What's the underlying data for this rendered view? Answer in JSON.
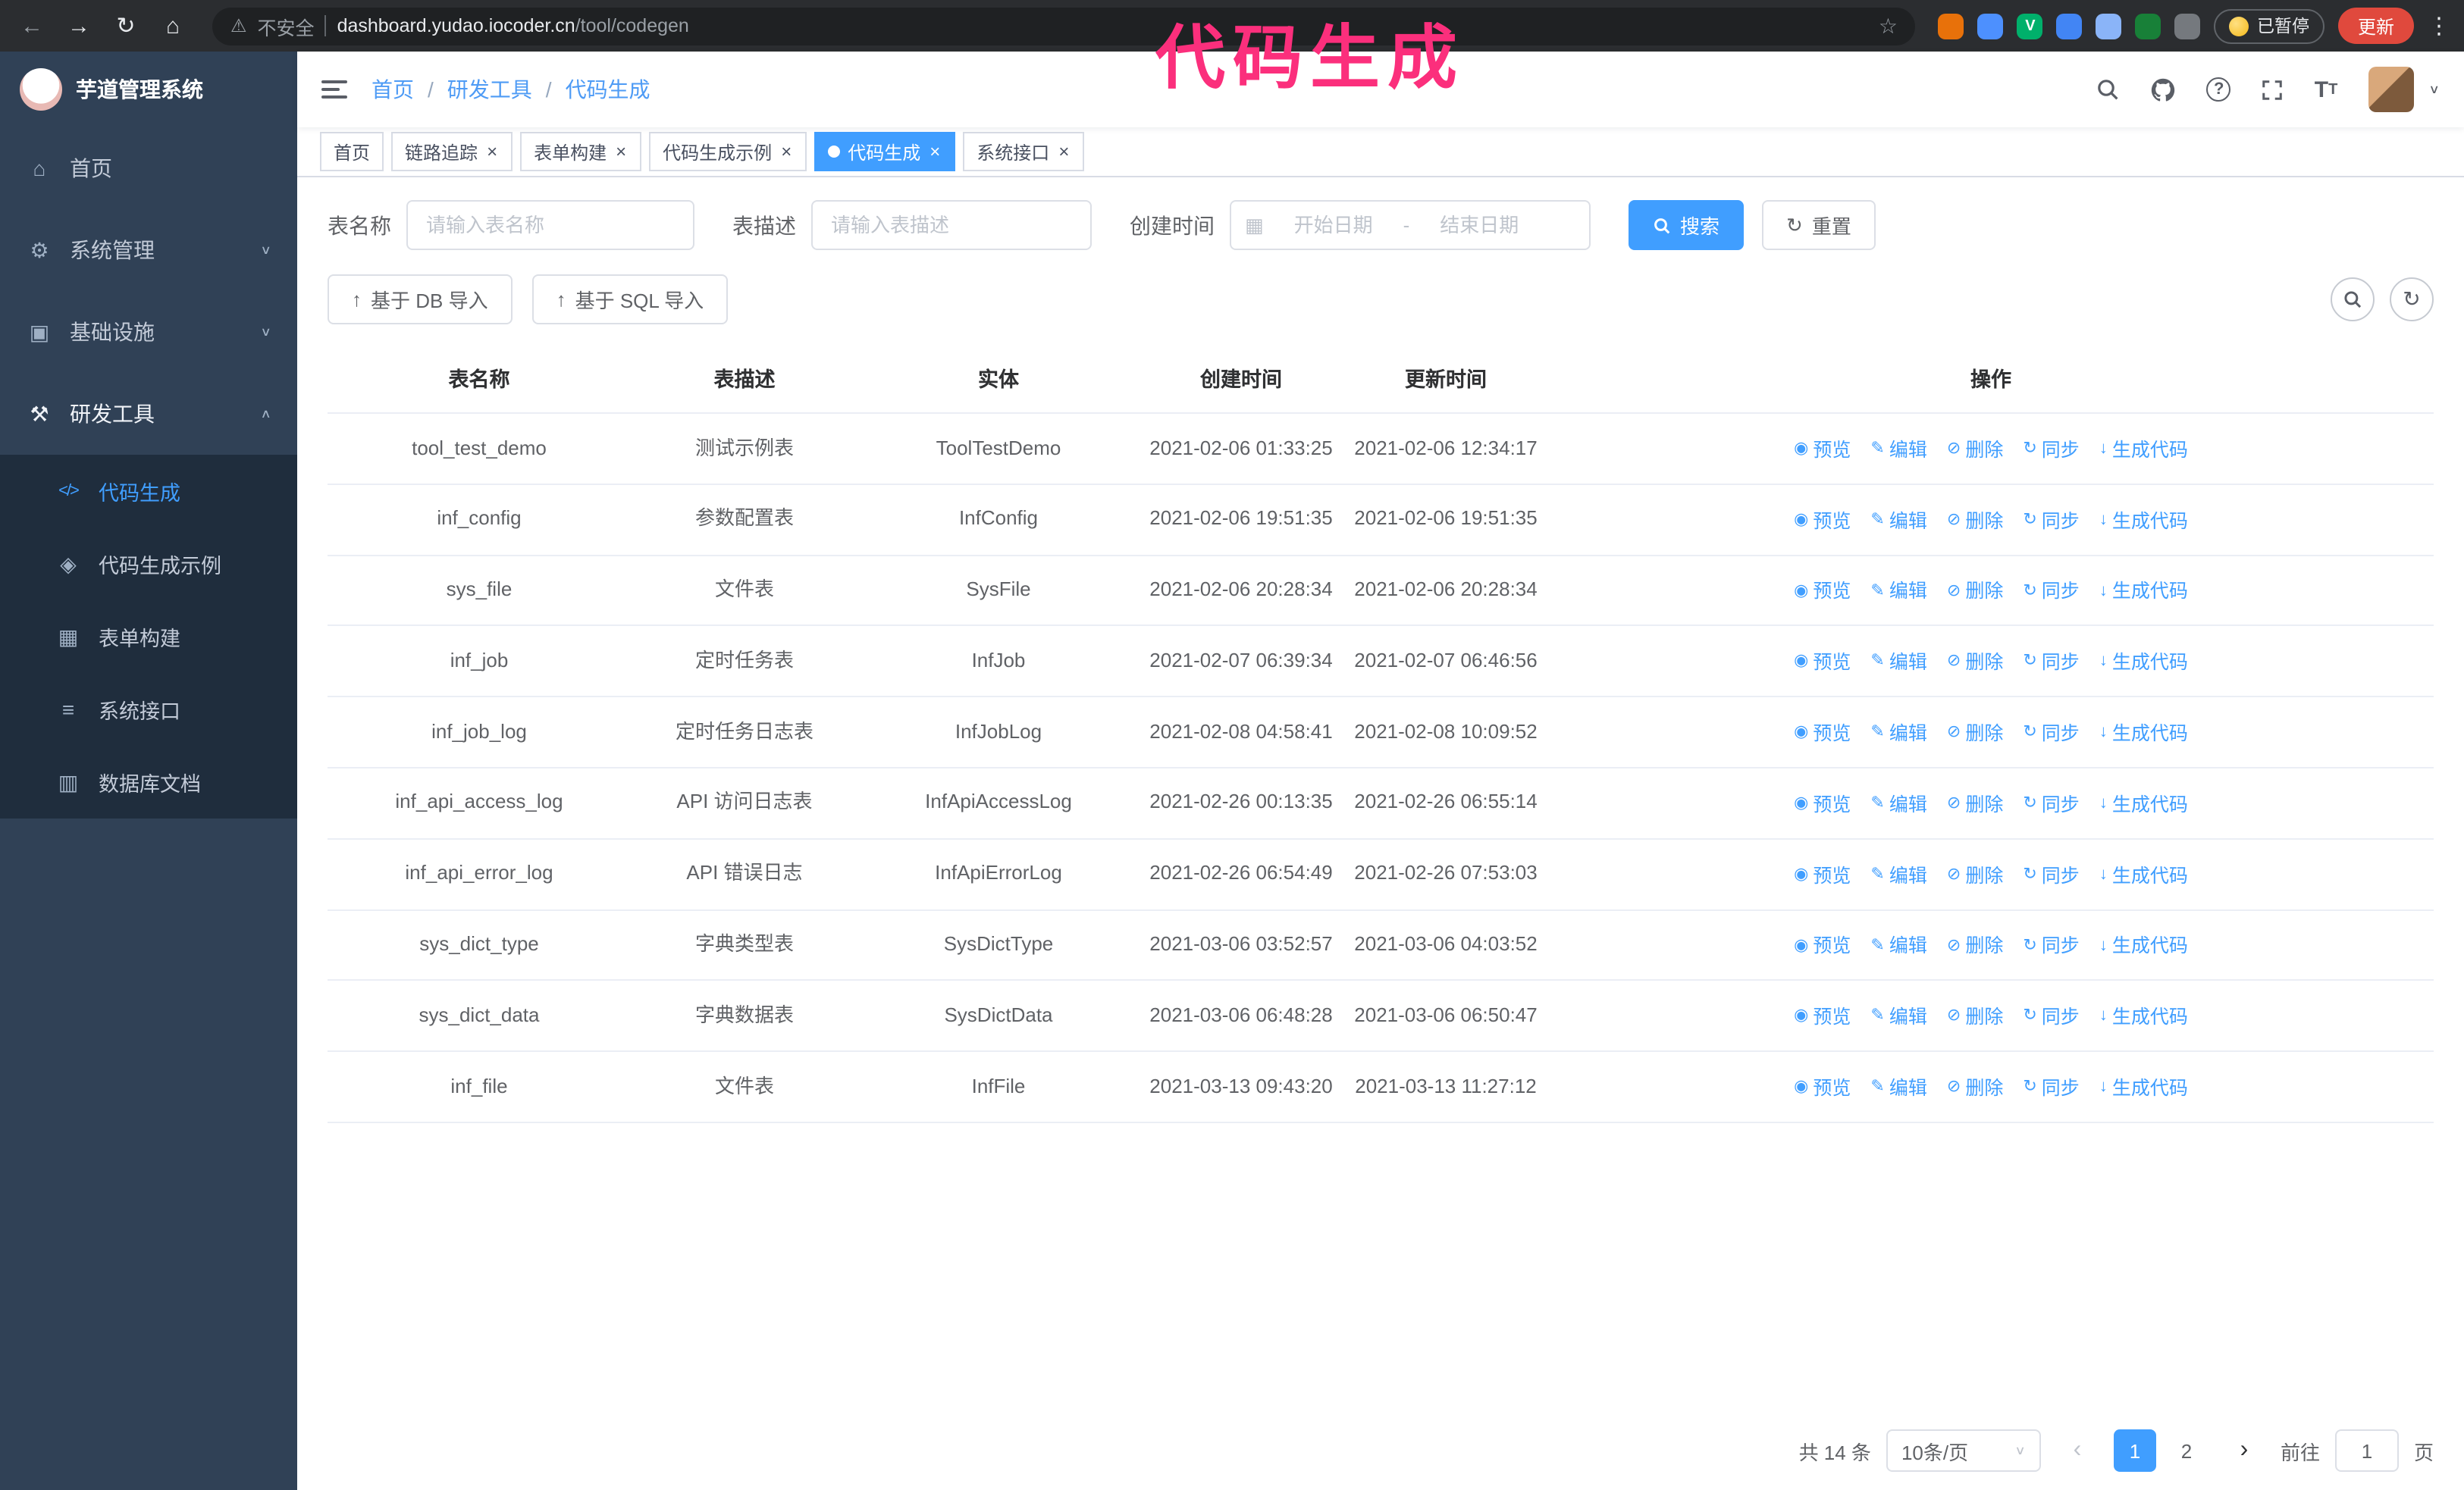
{
  "colors": {
    "primary": "#409eff",
    "sidebar_bg": "#304156",
    "submenu_bg": "#1f2d3d",
    "annotation_pink": "#fb2f7c",
    "update_red": "#e0493d",
    "browser_bar": "#2b2d30"
  },
  "annotation": "代码生成",
  "browser": {
    "warning": "不安全",
    "url_host": "dashboard.yudao.iocoder.cn",
    "url_path": "/tool/codegen",
    "paused_badge": "已暂停",
    "update_button": "更新",
    "extensions": [
      {
        "name": "extension-orange-icon",
        "bg": "#e8710a",
        "glyph": ""
      },
      {
        "name": "extension-blue-drop-icon",
        "bg": "#4d90fe",
        "glyph": ""
      },
      {
        "name": "extension-green-v-icon",
        "bg": "#00b06b",
        "glyph": "V"
      },
      {
        "name": "extension-people-icon",
        "bg": "#4285f4",
        "glyph": ""
      },
      {
        "name": "extension-translate-icon",
        "bg": "#8ab4f8",
        "glyph": ""
      },
      {
        "name": "extension-leaf-icon",
        "bg": "#188038",
        "glyph": ""
      },
      {
        "name": "extension-puzzle-icon",
        "bg": "#75797e",
        "glyph": ""
      }
    ]
  },
  "sidebar": {
    "logo_title": "芋道管理系统",
    "items": [
      {
        "key": "home",
        "label": "首页",
        "icon": "home-icon",
        "glyph": "⌂",
        "arrow": "",
        "open": false
      },
      {
        "key": "system",
        "label": "系统管理",
        "icon": "gear-icon",
        "glyph": "⚙",
        "arrow": "down",
        "open": false
      },
      {
        "key": "infrastructure",
        "label": "基础设施",
        "icon": "monitor-icon",
        "glyph": "▣",
        "arrow": "down",
        "open": false
      },
      {
        "key": "devtools",
        "label": "研发工具",
        "icon": "tools-icon",
        "glyph": "⚒",
        "arrow": "up",
        "open": true,
        "children": [
          {
            "key": "codegen",
            "label": "代码生成",
            "icon": "code-icon",
            "glyph": "</>",
            "active": true
          },
          {
            "key": "codegen-example",
            "label": "代码生成示例",
            "icon": "badge-icon",
            "glyph": "◈",
            "active": false
          },
          {
            "key": "form-builder",
            "label": "表单构建",
            "icon": "form-icon",
            "glyph": "▦",
            "active": false
          },
          {
            "key": "system-api",
            "label": "系统接口",
            "icon": "api-list-icon",
            "glyph": "≡",
            "active": false
          },
          {
            "key": "db-doc",
            "label": "数据库文档",
            "icon": "database-doc-icon",
            "glyph": "▥",
            "active": false
          }
        ]
      }
    ]
  },
  "header": {
    "breadcrumb": [
      "首页",
      "研发工具",
      "代码生成"
    ]
  },
  "tabs": [
    {
      "key": "home",
      "label": "首页",
      "closable": false,
      "active": false
    },
    {
      "key": "tracing",
      "label": "链路追踪",
      "closable": true,
      "active": false
    },
    {
      "key": "form-builder",
      "label": "表单构建",
      "closable": true,
      "active": false
    },
    {
      "key": "codegen-example",
      "label": "代码生成示例",
      "closable": true,
      "active": false
    },
    {
      "key": "codegen",
      "label": "代码生成",
      "closable": true,
      "active": true
    },
    {
      "key": "system-api",
      "label": "系统接口",
      "closable": true,
      "active": false
    }
  ],
  "filters": {
    "table_name_label": "表名称",
    "table_name_placeholder": "请输入表名称",
    "table_desc_label": "表描述",
    "table_desc_placeholder": "请输入表描述",
    "create_time_label": "创建时间",
    "start_date_placeholder": "开始日期",
    "date_separator": "-",
    "end_date_placeholder": "结束日期",
    "search_button": "搜索",
    "reset_button": "重置"
  },
  "toolbar": {
    "import_db": "基于 DB 导入",
    "import_sql": "基于 SQL 导入"
  },
  "table": {
    "columns": [
      "表名称",
      "表描述",
      "实体",
      "创建时间",
      "更新时间",
      "操作"
    ],
    "actions": [
      {
        "key": "preview",
        "label": "预览",
        "icon": "eye-icon",
        "glyph": "◉"
      },
      {
        "key": "edit",
        "label": "编辑",
        "icon": "edit-pencil-icon",
        "glyph": "✎"
      },
      {
        "key": "delete",
        "label": "删除",
        "icon": "trash-icon",
        "glyph": "⊘"
      },
      {
        "key": "sync",
        "label": "同步",
        "icon": "sync-icon",
        "glyph": "↻"
      },
      {
        "key": "generate",
        "label": "生成代码",
        "icon": "download-icon",
        "glyph": "↓"
      }
    ],
    "rows": [
      {
        "name": "tool_test_demo",
        "desc": "测试示例表",
        "entity": "ToolTestDemo",
        "created": "2021-02-06 01:33:25",
        "updated": "2021-02-06 12:34:17"
      },
      {
        "name": "inf_config",
        "desc": "参数配置表",
        "entity": "InfConfig",
        "created": "2021-02-06 19:51:35",
        "updated": "2021-02-06 19:51:35"
      },
      {
        "name": "sys_file",
        "desc": "文件表",
        "entity": "SysFile",
        "created": "2021-02-06 20:28:34",
        "updated": "2021-02-06 20:28:34"
      },
      {
        "name": "inf_job",
        "desc": "定时任务表",
        "entity": "InfJob",
        "created": "2021-02-07 06:39:34",
        "updated": "2021-02-07 06:46:56"
      },
      {
        "name": "inf_job_log",
        "desc": "定时任务日志表",
        "entity": "InfJobLog",
        "created": "2021-02-08 04:58:41",
        "updated": "2021-02-08 10:09:52"
      },
      {
        "name": "inf_api_access_log",
        "desc": "API 访问日志表",
        "entity": "InfApiAccessLog",
        "created": "2021-02-26 00:13:35",
        "updated": "2021-02-26 06:55:14"
      },
      {
        "name": "inf_api_error_log",
        "desc": "API 错误日志",
        "entity": "InfApiErrorLog",
        "created": "2021-02-26 06:54:49",
        "updated": "2021-02-26 07:53:03"
      },
      {
        "name": "sys_dict_type",
        "desc": "字典类型表",
        "entity": "SysDictType",
        "created": "2021-03-06 03:52:57",
        "updated": "2021-03-06 04:03:52"
      },
      {
        "name": "sys_dict_data",
        "desc": "字典数据表",
        "entity": "SysDictData",
        "created": "2021-03-06 06:48:28",
        "updated": "2021-03-06 06:50:47"
      },
      {
        "name": "inf_file",
        "desc": "文件表",
        "entity": "InfFile",
        "created": "2021-03-13 09:43:20",
        "updated": "2021-03-13 11:27:12"
      }
    ]
  },
  "pagination": {
    "total_label": "共 14 条",
    "page_size": "10条/页",
    "pages": [
      {
        "label": "1",
        "active": true
      },
      {
        "label": "2",
        "active": false
      }
    ],
    "goto_label": "前往",
    "goto_value": "1",
    "unit_label": "页"
  }
}
